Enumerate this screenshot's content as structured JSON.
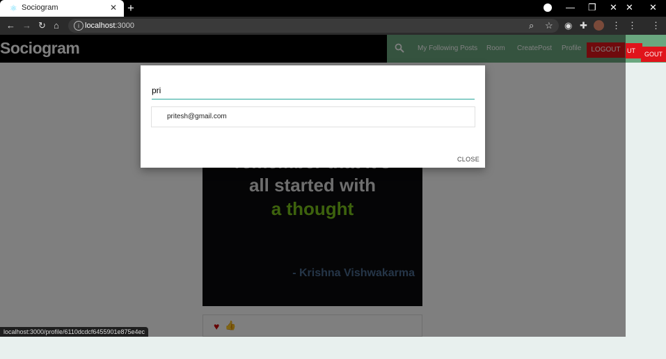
{
  "browser": {
    "tab_title": "Sociogram",
    "tab_close": "✕",
    "new_tab": "+",
    "address": "localhost",
    "address_port": ":3000",
    "window_controls": [
      "—",
      "❐",
      "✕"
    ],
    "secondary_controls": [
      "—",
      "✕"
    ]
  },
  "navbar": {
    "brand": "Sociogram",
    "links": [
      "My Following Posts",
      "Room",
      "CreatePost",
      "Profile"
    ],
    "logout": "LOGOUT",
    "overflow_logout_a": "UT",
    "overflow_logout_b": "GOUT"
  },
  "post": {
    "lines": [
      "remember that it's",
      "all started with"
    ],
    "highlight": "a thought",
    "author": "- Krishna Vishwakarma"
  },
  "search_modal": {
    "query": "pri",
    "results": [
      "pritesh@gmail.com"
    ],
    "close_label": "CLOSE"
  },
  "status_url": "localhost:3000/profile/6110dcdcf6455901e875e4ec",
  "colors": {
    "accent": "#26a69a",
    "nav_green": "#6aa77f",
    "logout_red": "#e0141b",
    "quote_green": "#7bc41a"
  }
}
